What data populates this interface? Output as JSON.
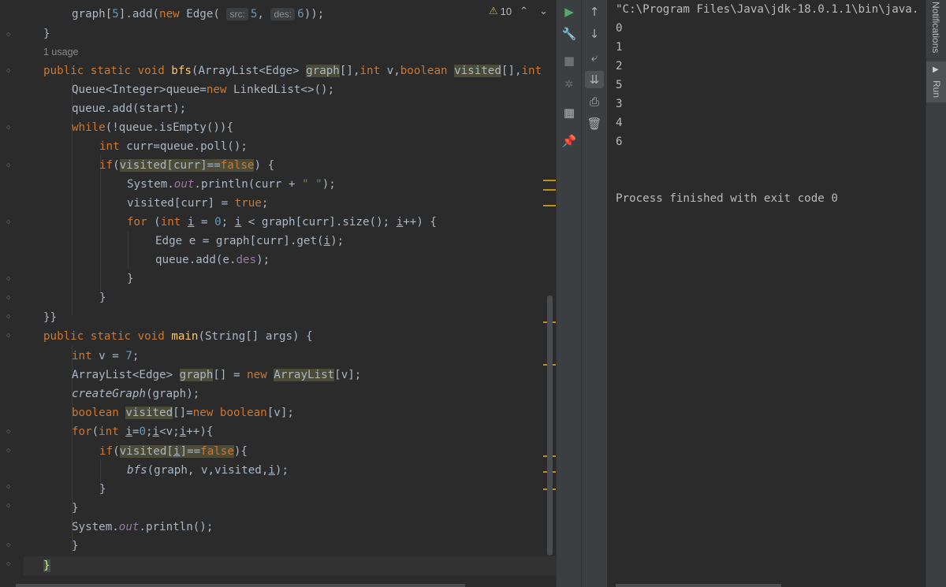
{
  "editor": {
    "warnings": {
      "count": "10"
    },
    "hints": {
      "src": "src:",
      "des": "des:"
    },
    "usage_label": "1 usage"
  },
  "console": {
    "command": "\"C:\\Program Files\\Java\\jdk-18.0.1.1\\bin\\java.",
    "output": [
      "0",
      "1",
      "2",
      "5",
      "3",
      "4",
      "6"
    ],
    "exit_message": "Process finished with exit code 0"
  },
  "side_tabs": {
    "notifications": "Notifications",
    "run": "Run"
  },
  "colors": {
    "background": "#2b2b2b",
    "keyword": "#cc7832",
    "function": "#ffc66d",
    "string": "#6a8759",
    "number": "#6897bb",
    "field": "#9876aa",
    "run_green": "#59a869"
  },
  "icons": [
    "run-icon",
    "wrench-icon",
    "stop-icon",
    "debug-icon",
    "layout-icon",
    "pin-icon",
    "up-arrow-icon",
    "down-arrow-icon",
    "soft-wrap-icon",
    "scroll-to-end-icon",
    "print-icon",
    "trash-icon",
    "warning-icon",
    "chevron-up-icon",
    "chevron-down-icon"
  ]
}
